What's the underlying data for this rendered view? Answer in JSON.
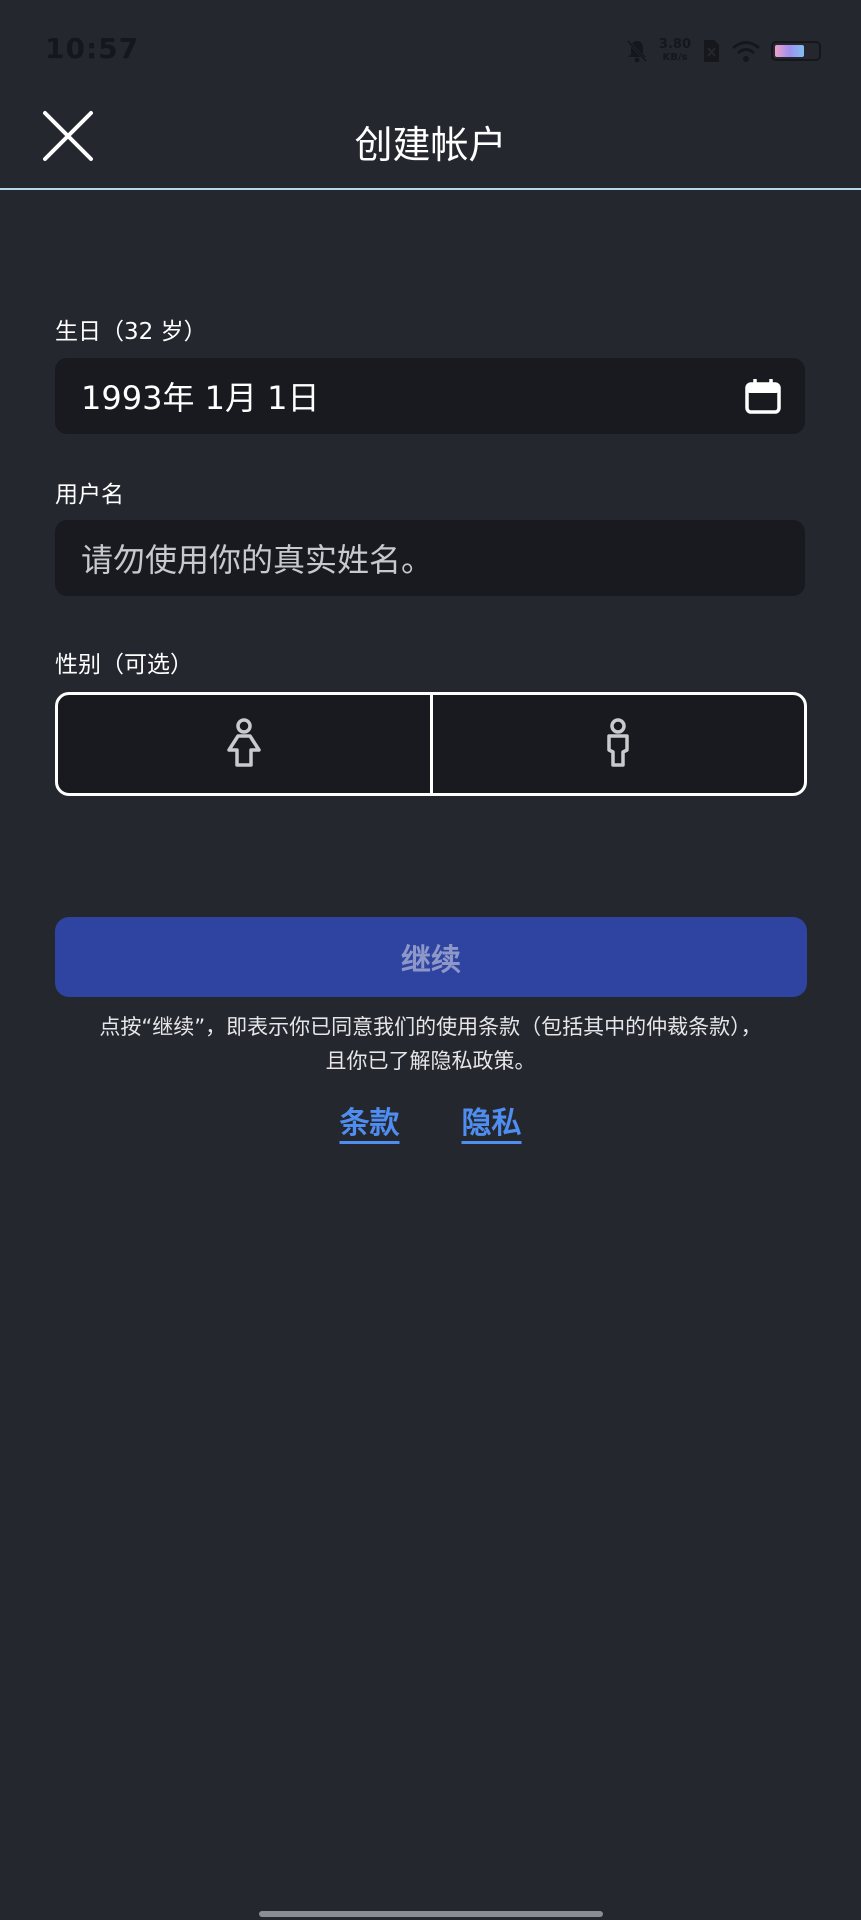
{
  "status_bar": {
    "time": "10:57",
    "net_speed_value": "3.80",
    "net_speed_unit": "KB/s"
  },
  "header": {
    "title": "创建帐户"
  },
  "birthday": {
    "label": "生日（32 岁）",
    "value": "1993年 1月 1日"
  },
  "username": {
    "label": "用户名",
    "placeholder": "请勿使用你的真实姓名。"
  },
  "gender": {
    "label": "性别（可选）",
    "options": [
      "female-icon",
      "male-icon"
    ]
  },
  "continue_button": {
    "label": "继续"
  },
  "consent": {
    "line1": "点按“继续”，即表示你已同意我们的使用条款（包括其中的仲裁条款），",
    "line2": "且你已了解隐私政策。"
  },
  "links": {
    "terms": "条款",
    "privacy": "隐私"
  },
  "colors": {
    "background": "#25272f",
    "input_bg": "#191a1f",
    "button": "#2f44a0",
    "link": "#4f8ef0",
    "divider": "#b9d6ec"
  }
}
